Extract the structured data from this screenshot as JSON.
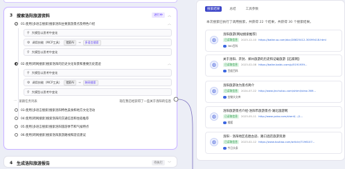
{
  "left": {
    "step3": {
      "number": "3",
      "title": "搜索洛阳旅游资料",
      "badge": "进行中",
      "subtasks": [
        {
          "title": "01.使用[多语言搜索]搜索洛阳主要旅游景点及特色介绍",
          "tools": [
            {
              "label": "大模型以思考中变化"
            },
            {
              "label": "调用技能（MCP工具）",
              "chip1": "猎索AI",
              "chip2": "多语言搜索"
            },
            {
              "label": "大模型以思考中变化"
            }
          ]
        },
        {
          "title": "02.使用[跨网搜索]搜索洛阳的历史文化背景和重要历史遗迹",
          "tools": [
            {
              "label": "大模型以思考中变化"
            },
            {
              "label": "调用技能（MCP工具）",
              "chip1": "猎索AI",
              "chip2": "跨网搜索"
            },
            {
              "label": "大模型以思考中变化"
            }
          ]
        }
      ],
      "thinking": {
        "left": "紧跟任务列表",
        "right": "现在我已经获得了一些关于洛阳的信息"
      },
      "pending": [
        "03.使用[多语言搜索]搜索洛阳特色美食和地方文化活动",
        "04.使用[跨网搜索]搜索洛阳的交通信息和住宿推荐",
        "05.使用[多语言搜索]搜索洛阳旅游季节和气候特点",
        "06.使用[跨网搜索]搜索洛阳旅游路线和游览建议"
      ]
    },
    "step4": {
      "number": "4",
      "title": "生成洛阳旅游报告",
      "badge": "待执行"
    }
  },
  "right": {
    "tabs": [
      "搜索结果",
      "总结",
      "工具参数"
    ],
    "summary": "本次搜索已执行了调用搜索，共获得 22 个结果，共获得 30 个搜索结果。",
    "results": [
      {
        "title": "洛阳旅游[网站搜索推荐]",
        "tag": "已读取信息",
        "date": "2023-12-10",
        "url": "https://baike.so.com/doc/28625412-30099418.html",
        "source": "360百科"
      },
      {
        "title": "关于洛阳、开封、郑州旅游的历史和记载旅游【石家网】",
        "tag": "已读取信息",
        "date": "2023-02-08",
        "url": "https://baike.baidu.com/p/5191939...",
        "source": "百度百科"
      },
      {
        "title": "洛阳旅游攻为景点简介",
        "tag": "已读取信息",
        "date": "2024-07-22",
        "url": "http://www.jinchutou.com/shtml/view-369...",
        "source": "金锄头文库"
      },
      {
        "title": "洛阳旅游景点介绍-洛阳市旅游景点-湖北旅游网",
        "tag": "已读取信息",
        "date": "2023-05-11",
        "url": "http://www.yoka.com/shenf/.../1...",
        "source": "搜狐"
      },
      {
        "title": "洛阳 - 洛阳地区名胜古迹、路口酒店旅游资源",
        "tag": "已读取信息",
        "date": "2023-02-12",
        "url": "https://www.toutiao.com/article/7196107...",
        "source": "今日头条"
      }
    ]
  },
  "colors": {
    "accent": "#3d46c8",
    "purple": "#6b4dff",
    "green": "#2b9a4a"
  }
}
